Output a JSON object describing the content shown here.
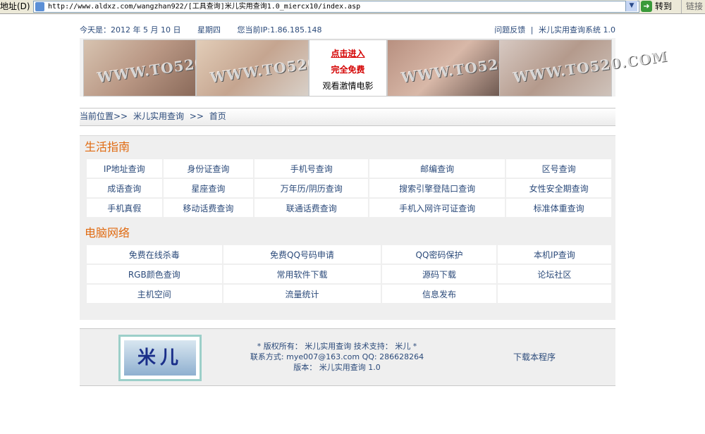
{
  "browser": {
    "address_label": "地址(D)",
    "url": "http://www.aldxz.com/wangzhan922/[工具查询]米儿实用查询1.0_miercx10/index.asp",
    "go_label": "转到",
    "links_label": "链接"
  },
  "topbar": {
    "date": "今天是：2012 年 5 月 10 日",
    "weekday": "星期四",
    "ip": "您当前IP:1.86.185.148",
    "feedback": "问题反馈",
    "separator": "|",
    "system": "米儿实用查询系统 1.0"
  },
  "banner": {
    "watermark": "WWW.TO520.COM",
    "ad_line1": "点击进入",
    "ad_line2": "完全免费",
    "ad_line3": "观看激情电影"
  },
  "breadcrumb": {
    "prefix": "当前位置>>",
    "site": "米儿实用查询",
    "sep": ">>",
    "page": "首页"
  },
  "life": {
    "title": "生活指南",
    "rows": [
      [
        "IP地址查询",
        "身份证查询",
        "手机号查询",
        "邮编查询",
        "区号查询"
      ],
      [
        "成语查询",
        "星座查询",
        "万年历/阴历查询",
        "搜索引擎登陆口查询",
        "女性安全期查询"
      ],
      [
        "手机真假",
        "移动话费查询",
        "联通话费查询",
        "手机入网许可证查询",
        "标准体重查询"
      ]
    ]
  },
  "computer": {
    "title": "电脑网络",
    "rows": [
      [
        "免费在线杀毒",
        "免费QQ号码申请",
        "QQ密码保护",
        "本机IP查询"
      ],
      [
        "RGB颜色查询",
        "常用软件下载",
        "源码下载",
        "论坛社区"
      ],
      [
        "主机空间",
        "流量统计",
        "信息发布",
        ""
      ]
    ]
  },
  "footer": {
    "logo_text": "米儿",
    "line1": "* 版权所有： 米儿实用查询  技术支持： 米儿  *",
    "line2": "联系方式: mye007@163.com QQ: 286628264",
    "line3": "版本： 米儿实用查询 1.0",
    "download": "下载本程序"
  },
  "colors": {
    "link": "#2b4a7a",
    "section_title": "#e06a10",
    "ad_red": "#d40000",
    "panel_bg": "#efefef"
  }
}
